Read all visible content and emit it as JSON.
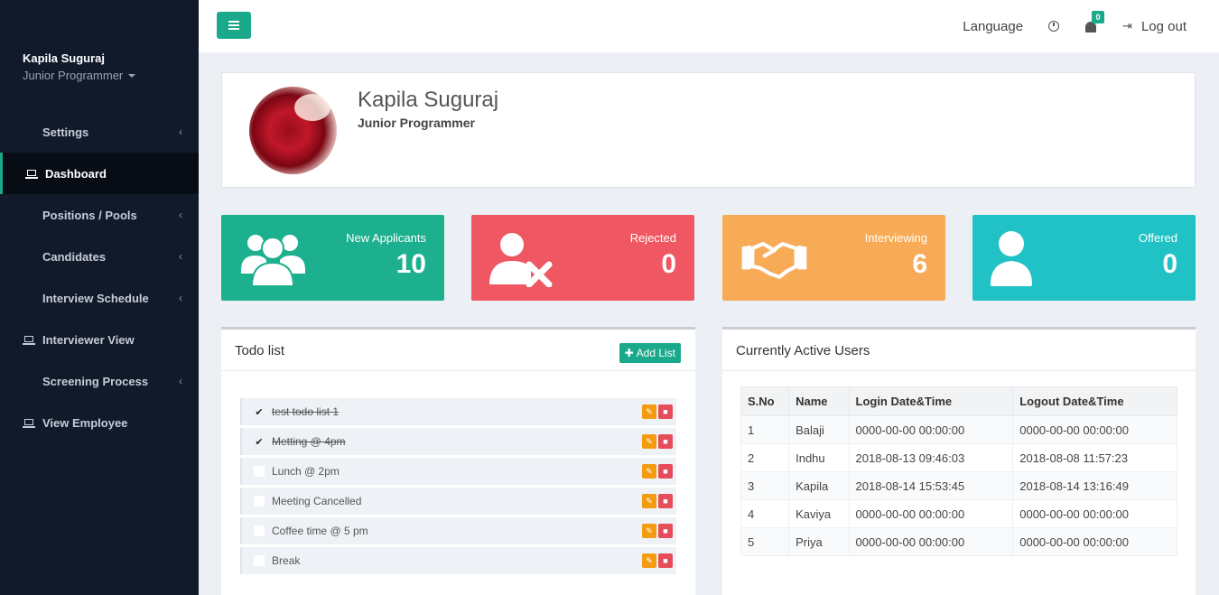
{
  "sidebar": {
    "user_name": "Kapila Suguraj",
    "user_role": "Junior Programmer",
    "items": [
      {
        "label": "Settings",
        "icon": "grid-icon"
      },
      {
        "label": "Dashboard",
        "icon": "laptop-icon"
      },
      {
        "label": "Positions / Pools",
        "icon": "grid-icon"
      },
      {
        "label": "Candidates",
        "icon": "grid-icon"
      },
      {
        "label": "Interview Schedule",
        "icon": "grid-icon"
      },
      {
        "label": "Interviewer View",
        "icon": "laptop-icon"
      },
      {
        "label": "Screening Process",
        "icon": "grid-icon"
      },
      {
        "label": "View Employee",
        "icon": "laptop-icon"
      }
    ],
    "chevron": "‹"
  },
  "topbar": {
    "language": "Language",
    "notification_count": "0",
    "logout": "Log out"
  },
  "profile": {
    "name": "Kapila Suguraj",
    "role": "Junior Programmer"
  },
  "stats": [
    {
      "label": "New Applicants",
      "value": "10",
      "color": "#1cb08e"
    },
    {
      "label": "Rejected",
      "value": "0",
      "color": "#ef5762"
    },
    {
      "label": "Interviewing",
      "value": "6",
      "color": "#f7ab57"
    },
    {
      "label": "Offered",
      "value": "0",
      "color": "#20c2c6"
    }
  ],
  "todo": {
    "title": "Todo list",
    "add_label": "Add List",
    "items": [
      {
        "text": "test todo list 1",
        "done": true
      },
      {
        "text": "Metting @ 4pm",
        "done": true
      },
      {
        "text": "Lunch @ 2pm",
        "done": false
      },
      {
        "text": "Meeting Cancelled",
        "done": false
      },
      {
        "text": "Coffee time @ 5 pm",
        "done": false
      },
      {
        "text": "Break",
        "done": false
      }
    ]
  },
  "users": {
    "title": "Currently Active Users",
    "columns": [
      "S.No",
      "Name",
      "Login Date&Time",
      "Logout Date&Time"
    ],
    "rows": [
      [
        "1",
        "Balaji",
        "0000-00-00 00:00:00",
        "0000-00-00 00:00:00"
      ],
      [
        "2",
        "Indhu",
        "2018-08-13 09:46:03",
        "2018-08-08 11:57:23"
      ],
      [
        "3",
        "Kapila",
        "2018-08-14 15:53:45",
        "2018-08-14 13:16:49"
      ],
      [
        "4",
        "Kaviya",
        "0000-00-00 00:00:00",
        "0000-00-00 00:00:00"
      ],
      [
        "5",
        "Priya",
        "0000-00-00 00:00:00",
        "0000-00-00 00:00:00"
      ]
    ]
  }
}
